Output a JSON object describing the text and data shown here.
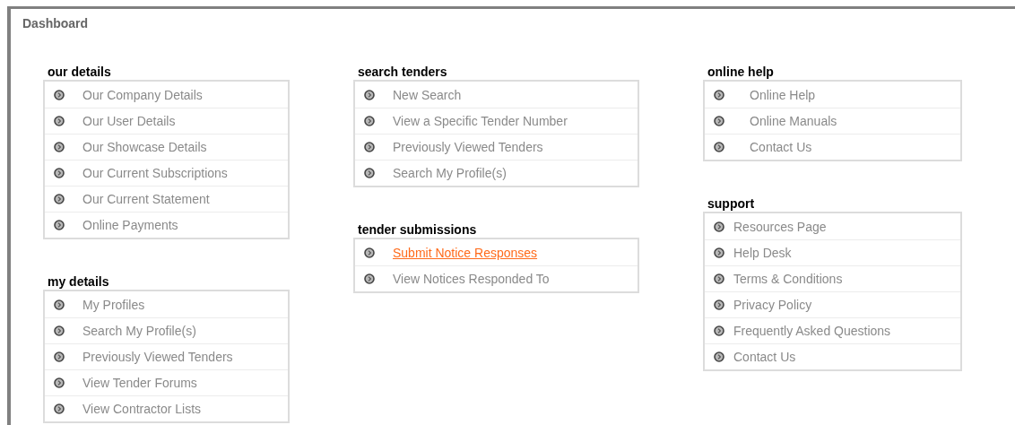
{
  "title": "Dashboard",
  "columns": [
    [
      {
        "title": "our details",
        "items": [
          {
            "label": "Our Company Details",
            "active": false
          },
          {
            "label": "Our User Details",
            "active": false
          },
          {
            "label": "Our Showcase Details",
            "active": false
          },
          {
            "label": "Our Current Subscriptions",
            "active": false
          },
          {
            "label": "Our Current Statement",
            "active": false
          },
          {
            "label": "Online Payments",
            "active": false
          }
        ]
      },
      {
        "title": "my details",
        "items": [
          {
            "label": "My Profiles",
            "active": false
          },
          {
            "label": "Search My Profile(s)",
            "active": false
          },
          {
            "label": "Previously Viewed Tenders",
            "active": false
          },
          {
            "label": "View Tender Forums",
            "active": false
          },
          {
            "label": "View Contractor Lists",
            "active": false
          }
        ]
      }
    ],
    [
      {
        "title": "search tenders",
        "items": [
          {
            "label": "New Search",
            "active": false
          },
          {
            "label": "View a Specific Tender Number",
            "active": false
          },
          {
            "label": "Previously Viewed Tenders",
            "active": false
          },
          {
            "label": "Search My Profile(s)",
            "active": false
          }
        ]
      },
      {
        "title": "tender submissions",
        "items": [
          {
            "label": "Submit Notice Responses",
            "active": true
          },
          {
            "label": "View Notices Responded To",
            "active": false
          }
        ]
      }
    ],
    [
      {
        "title": "online help",
        "items": [
          {
            "label": "Online Help",
            "active": false
          },
          {
            "label": "Online Manuals",
            "active": false
          },
          {
            "label": "Contact Us",
            "active": false
          }
        ]
      },
      {
        "title": "support",
        "items": [
          {
            "label": "Resources Page",
            "active": false
          },
          {
            "label": "Help Desk",
            "active": false
          },
          {
            "label": "Terms & Conditions",
            "active": false
          },
          {
            "label": "Privacy Policy",
            "active": false
          },
          {
            "label": "Frequently Asked Questions",
            "active": false
          },
          {
            "label": "Contact Us",
            "active": false
          }
        ]
      }
    ]
  ]
}
